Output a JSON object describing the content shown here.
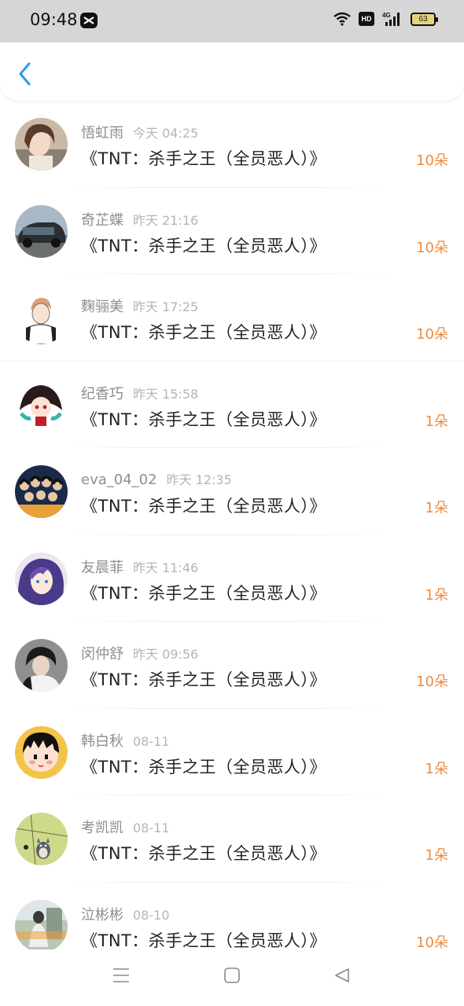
{
  "status": {
    "time": "09:48",
    "hd": "HD",
    "network": "4G",
    "battery": "63"
  },
  "header": {
    "back_icon": "chevron-left-icon"
  },
  "list": [
    {
      "name": "悟虹雨",
      "time": "今天 04:25",
      "title": "《TNT：杀手之王（全员恶人）》",
      "count": "10朵"
    },
    {
      "name": "奇芷蝶",
      "time": "昨天 21:16",
      "title": "《TNT：杀手之王（全员恶人）》",
      "count": "10朵"
    },
    {
      "name": "麴骊美",
      "time": "昨天 17:25",
      "title": "《TNT：杀手之王（全员恶人）》",
      "count": "10朵"
    },
    {
      "name": "纪香巧",
      "time": "昨天 15:58",
      "title": "《TNT：杀手之王（全员恶人）》",
      "count": "1朵"
    },
    {
      "name": "eva_04_02",
      "time": "昨天 12:35",
      "title": "《TNT：杀手之王（全员恶人）》",
      "count": "1朵"
    },
    {
      "name": "友晨菲",
      "time": "昨天 11:46",
      "title": "《TNT：杀手之王（全员恶人）》",
      "count": "1朵"
    },
    {
      "name": "闵仲舒",
      "time": "昨天 09:56",
      "title": "《TNT：杀手之王（全员恶人）》",
      "count": "10朵"
    },
    {
      "name": "韩白秋",
      "time": "08-11",
      "title": "《TNT：杀手之王（全员恶人）》",
      "count": "1朵"
    },
    {
      "name": "考凯凯",
      "time": "08-11",
      "title": "《TNT：杀手之王（全员恶人）》",
      "count": "1朵"
    },
    {
      "name": "泣彬彬",
      "time": "08-10",
      "title": "《TNT：杀手之王（全员恶人）》",
      "count": "10朵"
    }
  ],
  "colors": {
    "accent": "#2a9ee8",
    "count": "#f08a3c",
    "status_bar": "#d6d6d6"
  }
}
